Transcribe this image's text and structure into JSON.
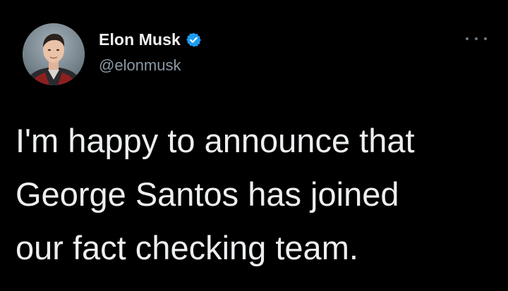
{
  "author": {
    "display_name": "Elon Musk",
    "handle": "@elonmusk",
    "verified": true
  },
  "tweet": {
    "lines": [
      "I'm happy to announce that",
      "George Santos has joined",
      "our fact checking team."
    ]
  },
  "icons": {
    "verified": "verified-badge-icon",
    "more": "more-options-icon",
    "avatar": "profile-avatar"
  },
  "colors": {
    "background": "#000000",
    "text_primary": "#eceef0",
    "text_secondary": "#8b98a5",
    "verified_blue": "#1d9bf0"
  }
}
